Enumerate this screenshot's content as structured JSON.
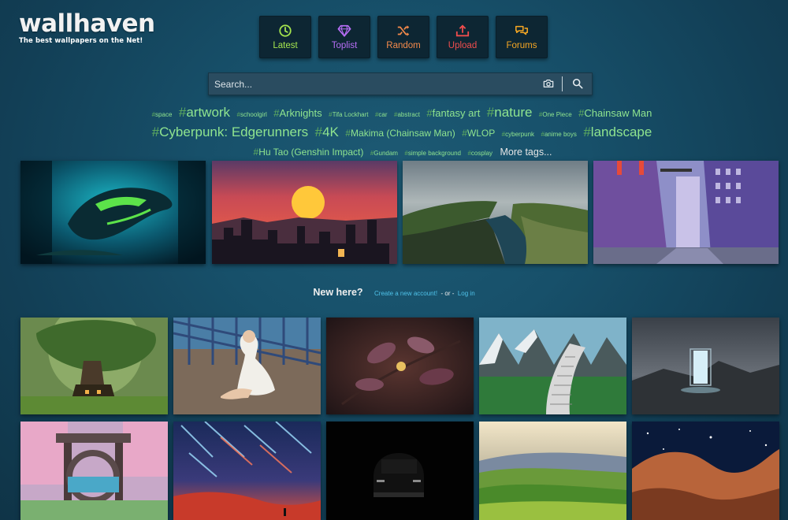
{
  "logo": {
    "title": "wallhaven",
    "tagline": "The best wallpapers on the Net!"
  },
  "nav": [
    {
      "label": "Latest",
      "icon": "clock-icon",
      "color": "#a4e44e"
    },
    {
      "label": "Toplist",
      "icon": "diamond-icon",
      "color": "#b86ef7"
    },
    {
      "label": "Random",
      "icon": "shuffle-icon",
      "color": "#f58a4b"
    },
    {
      "label": "Upload",
      "icon": "upload-icon",
      "color": "#f04d4d"
    },
    {
      "label": "Forums",
      "icon": "comments-icon",
      "color": "#f5a623"
    }
  ],
  "search": {
    "placeholder": "Search..."
  },
  "tags": [
    {
      "name": "space",
      "size": "xs"
    },
    {
      "name": "artwork",
      "size": "l"
    },
    {
      "name": "schoolgirl",
      "size": "xs"
    },
    {
      "name": "Arknights",
      "size": "m"
    },
    {
      "name": "Tifa Lockhart",
      "size": "xs"
    },
    {
      "name": "car",
      "size": "xs"
    },
    {
      "name": "abstract",
      "size": "xs"
    },
    {
      "name": "fantasy art",
      "size": "m"
    },
    {
      "name": "nature",
      "size": "l"
    },
    {
      "name": "One Piece",
      "size": "xs"
    },
    {
      "name": "Chainsaw Man",
      "size": "m"
    },
    {
      "name": "Cyberpunk: Edgerunners",
      "size": "l"
    },
    {
      "name": "4K",
      "size": "l"
    },
    {
      "name": "Makima (Chainsaw Man)",
      "size": "s"
    },
    {
      "name": "WLOP",
      "size": "s"
    },
    {
      "name": "cyberpunk",
      "size": "xs"
    },
    {
      "name": "anime boys",
      "size": "xs"
    },
    {
      "name": "landscape",
      "size": "l"
    },
    {
      "name": "Hu Tao (Genshin Impact)",
      "size": "s"
    },
    {
      "name": "Gundam",
      "size": "xs"
    },
    {
      "name": "simple background",
      "size": "xs"
    },
    {
      "name": "cosplay",
      "size": "xs"
    }
  ],
  "more_tags": "More tags...",
  "featured": [
    {
      "subject": "underwater shark artwork"
    },
    {
      "subject": "sunset city skyline"
    },
    {
      "subject": "sea cliffs landscape"
    },
    {
      "subject": "anime city street"
    }
  ],
  "new_here": {
    "question": "New here?",
    "create": "Create a new account!",
    "or": "- or -",
    "login": "Log in"
  },
  "latest": [
    {
      "subject": "giant tree house"
    },
    {
      "subject": "woman in white dress on bridge"
    },
    {
      "subject": "pink flowers on branch"
    },
    {
      "subject": "keyboard road through mountains"
    },
    {
      "subject": "glowing doorway landscape"
    },
    {
      "subject": "torii gate pixel art"
    },
    {
      "subject": "starry night meteors"
    },
    {
      "subject": "dark car silhouette"
    },
    {
      "subject": "green rolling hills"
    },
    {
      "subject": "nebula space"
    }
  ]
}
